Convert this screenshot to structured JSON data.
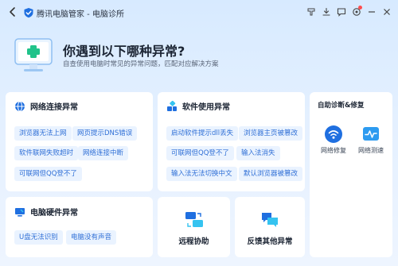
{
  "titlebar": {
    "title": "腾讯电脑管家 - 电脑诊所",
    "icons": [
      "brush-icon",
      "download-icon",
      "message-icon",
      "settings-icon",
      "minimize-icon",
      "close-icon"
    ]
  },
  "hero": {
    "title": "你遇到以下哪种异常?",
    "subtitle": "自查使用电脑时常见的异常问题，匹配对应解决方案"
  },
  "network": {
    "title": "网络连接异常",
    "items": [
      "浏览器无法上网",
      "网页提示DNS错误",
      "软件联网失败超时",
      "网络连接中断",
      "可联网但QQ登不了"
    ]
  },
  "software": {
    "title": "软件使用异常",
    "items": [
      "启动软件提示dll丢失",
      "浏览器主页被篡改",
      "可联网但QQ登不了",
      "输入法消失",
      "输入法无法切换中文",
      "默认浏览器被篡改"
    ]
  },
  "auto": {
    "title": "自助诊断&修复",
    "tools": [
      "网络修复",
      "网络测速"
    ]
  },
  "hardware": {
    "title": "电脑硬件异常",
    "items": [
      "U盘无法识别",
      "电脑没有声音"
    ]
  },
  "remote": {
    "label": "远程协助"
  },
  "feedback": {
    "label": "反馈其他异常"
  },
  "colors": {
    "accent": "#2f6fd6",
    "chip_bg": "#eaf3ff",
    "badge": "#ff4d4f"
  }
}
